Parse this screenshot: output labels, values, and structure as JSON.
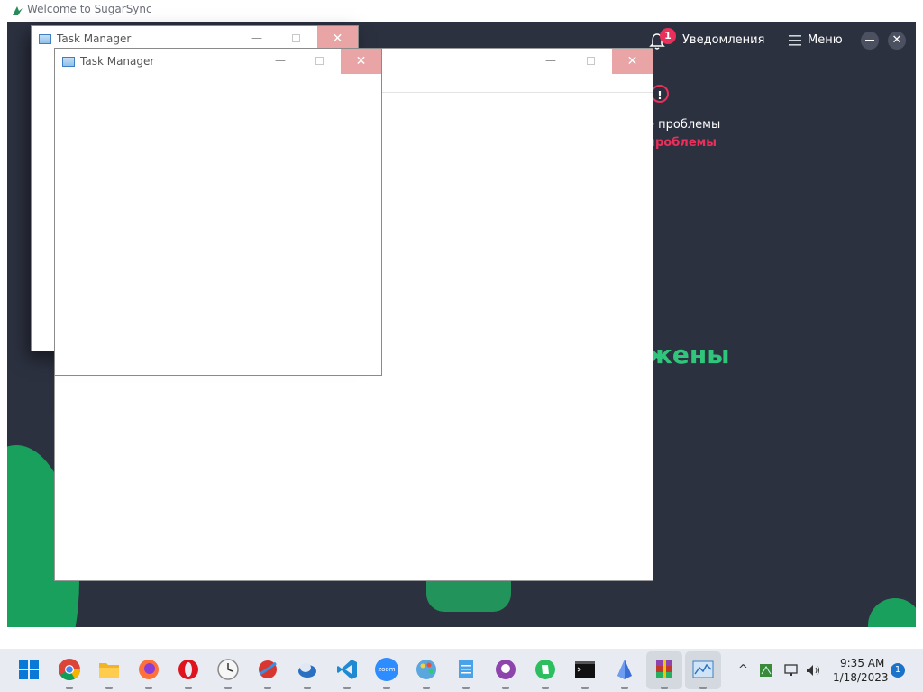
{
  "sugarsync": {
    "window_title": "Welcome to SugarSync",
    "notifications_label": "Уведомления",
    "notifications_count": "1",
    "menu_label": "Меню",
    "close_glyph": "✕",
    "warning_glyph": "!",
    "problem_line_1": "е проблемы",
    "problem_line_2": "проблемы",
    "headline_fragment": "жены",
    "colors": {
      "background": "#2c3140",
      "accent_green": "#2fc57a",
      "alert_red": "#e8305a"
    }
  },
  "task_manager": {
    "title": "Task Manager",
    "minimize_glyph": "—",
    "close_glyph": "✕"
  },
  "taskbar": {
    "apps": [
      {
        "name": "start-button",
        "icon": "windows-logo-icon"
      },
      {
        "name": "chrome",
        "icon": "chrome-icon"
      },
      {
        "name": "file-explorer",
        "icon": "folder-icon"
      },
      {
        "name": "firefox",
        "icon": "firefox-icon"
      },
      {
        "name": "opera",
        "icon": "opera-icon"
      },
      {
        "name": "clock-app",
        "icon": "clock-icon"
      },
      {
        "name": "ccleaner",
        "icon": "ccleaner-icon"
      },
      {
        "name": "cloud-app",
        "icon": "cloud-icon"
      },
      {
        "name": "vscode",
        "icon": "vscode-icon"
      },
      {
        "name": "zoom",
        "icon": "zoom-icon",
        "label": "zoom"
      },
      {
        "name": "paint-app",
        "icon": "palette-icon"
      },
      {
        "name": "notepad",
        "icon": "notepad-icon"
      },
      {
        "name": "github-desktop",
        "icon": "github-icon"
      },
      {
        "name": "evernote",
        "icon": "evernote-icon"
      },
      {
        "name": "terminal",
        "icon": "terminal-icon"
      },
      {
        "name": "crystal-app",
        "icon": "crystal-icon"
      },
      {
        "name": "winrar",
        "icon": "winrar-icon"
      },
      {
        "name": "task-manager",
        "icon": "task-manager-icon"
      }
    ],
    "clock_time": "9:35 AM",
    "clock_date": "1/18/2023",
    "notification_count": "1"
  }
}
